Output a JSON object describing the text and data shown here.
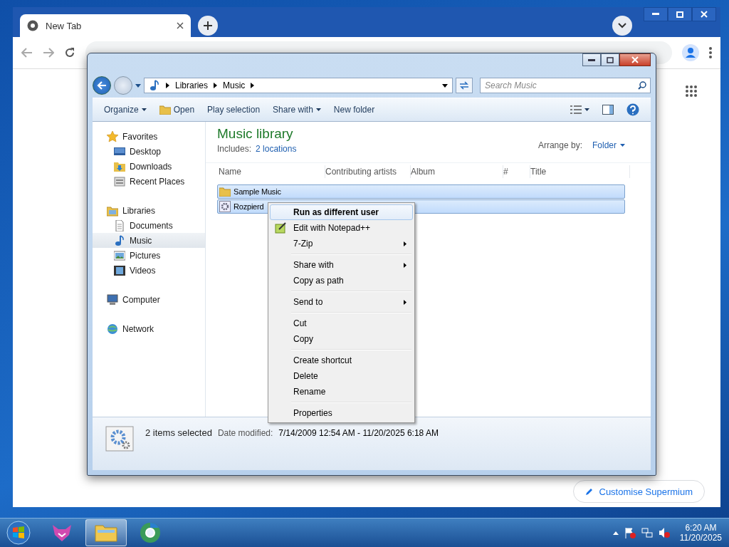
{
  "browser": {
    "tab_title": "New Tab",
    "customise_button": "Customise Supermium"
  },
  "explorer": {
    "breadcrumb": [
      "Libraries",
      "Music"
    ],
    "search": {
      "placeholder": "Search Music"
    },
    "toolbar": [
      {
        "label": "Organize",
        "dropdown": true
      },
      {
        "label": "Open",
        "dropdown": false
      },
      {
        "label": "Play selection",
        "dropdown": false
      },
      {
        "label": "Share with",
        "dropdown": true
      },
      {
        "label": "New folder",
        "dropdown": false
      }
    ],
    "nav": [
      {
        "label": "Favorites",
        "kind": "star",
        "selected": false,
        "children": [
          {
            "label": "Desktop",
            "kind": "desktop",
            "selected": false
          },
          {
            "label": "Downloads",
            "kind": "downloads",
            "selected": false
          },
          {
            "label": "Recent Places",
            "kind": "recent",
            "selected": false
          }
        ]
      },
      {
        "label": "Libraries",
        "kind": "libraries",
        "selected": false,
        "children": [
          {
            "label": "Documents",
            "kind": "document",
            "selected": false
          },
          {
            "label": "Music",
            "kind": "music",
            "selected": true
          },
          {
            "label": "Pictures",
            "kind": "pictures",
            "selected": false
          },
          {
            "label": "Videos",
            "kind": "videos",
            "selected": false
          }
        ]
      },
      {
        "label": "Computer",
        "kind": "computer",
        "selected": false
      },
      {
        "label": "Network",
        "kind": "network",
        "selected": false
      }
    ],
    "library": {
      "title": "Music library",
      "includes_label": "Includes:",
      "includes_link": "2 locations",
      "arrange_label": "Arrange by:",
      "arrange_value": "Folder"
    },
    "columns": [
      "Name",
      "Contributing artists",
      "Album",
      "#",
      "Title"
    ],
    "files": [
      {
        "name": "Sample Music",
        "kind": "folder",
        "selected": true
      },
      {
        "name": "Rozpierd",
        "kind": "program",
        "selected": true
      }
    ],
    "status": {
      "count": "2 items selected",
      "date_label": "Date modified:",
      "date_value": "7/14/2009 12:54 AM - 11/20/2025 6:18 AM"
    }
  },
  "context_menu": [
    [
      {
        "label": "Run as different user",
        "bold": true,
        "selected": true,
        "submenu": false
      },
      {
        "label": "Edit with Notepad++",
        "bold": false,
        "selected": false,
        "submenu": false,
        "kind": "notepad"
      },
      {
        "label": "7-Zip",
        "bold": false,
        "selected": false,
        "submenu": true
      }
    ],
    [
      {
        "label": "Share with",
        "bold": false,
        "selected": false,
        "submenu": true
      },
      {
        "label": "Copy as path",
        "bold": false,
        "selected": false,
        "submenu": false
      }
    ],
    [
      {
        "label": "Send to",
        "bold": false,
        "selected": false,
        "submenu": true
      }
    ],
    [
      {
        "label": "Cut",
        "bold": false,
        "selected": false,
        "submenu": false
      },
      {
        "label": "Copy",
        "bold": false,
        "selected": false,
        "submenu": false
      }
    ],
    [
      {
        "label": "Create shortcut",
        "bold": false,
        "selected": false,
        "submenu": false
      },
      {
        "label": "Delete",
        "bold": false,
        "selected": false,
        "submenu": false
      },
      {
        "label": "Rename",
        "bold": false,
        "selected": false,
        "submenu": false
      }
    ],
    [
      {
        "label": "Properties",
        "bold": false,
        "selected": false,
        "submenu": false
      }
    ]
  ],
  "taskbar": {
    "apps": [
      {
        "kind": "fox",
        "selected": false
      },
      {
        "kind": "folder",
        "selected": true
      },
      {
        "kind": "browser",
        "selected": false
      }
    ],
    "time": "6:20 AM",
    "date": "11/20/2025"
  }
}
